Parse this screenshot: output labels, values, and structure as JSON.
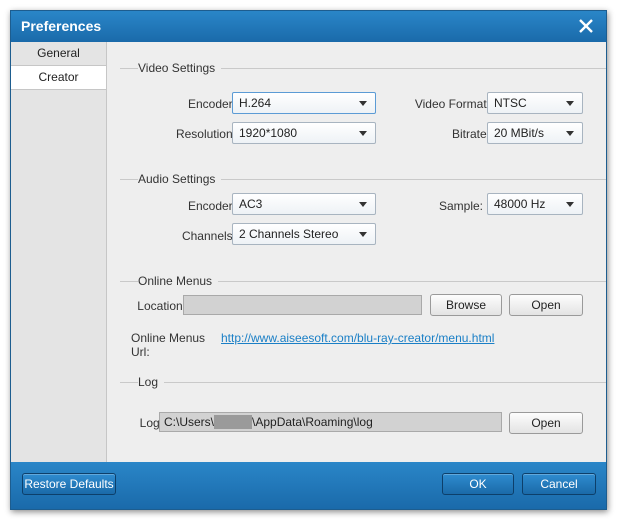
{
  "window": {
    "title": "Preferences"
  },
  "sidebar": {
    "items": [
      {
        "label": "General"
      },
      {
        "label": "Creator"
      }
    ]
  },
  "video": {
    "section_title": "Video Settings",
    "encoder_label": "Encoder:",
    "encoder_value": "H.264",
    "format_label": "Video Format:",
    "format_value": "NTSC",
    "resolution_label": "Resolution:",
    "resolution_value": "1920*1080",
    "bitrate_label": "Bitrate:",
    "bitrate_value": "20 MBit/s"
  },
  "audio": {
    "section_title": "Audio Settings",
    "encoder_label": "Encoder:",
    "encoder_value": "AC3",
    "sample_label": "Sample:",
    "sample_value": "48000 Hz",
    "channels_label": "Channels:",
    "channels_value": "2 Channels Stereo"
  },
  "online": {
    "section_title": "Online Menus",
    "location_label": "Location:",
    "location_value": "",
    "browse_label": "Browse",
    "open_label": "Open",
    "url_label": "Online Menus Url:",
    "url_value": "http://www.aiseesoft.com/blu-ray-creator/menu.html"
  },
  "log": {
    "section_title": "Log",
    "label": "Log:",
    "path_prefix": "C:\\Users\\",
    "path_suffix": "\\AppData\\Roaming\\log",
    "open_label": "Open"
  },
  "footer": {
    "restore_label": "Restore Defaults",
    "ok_label": "OK",
    "cancel_label": "Cancel"
  },
  "colors": {
    "titlebar": "#1e74b6",
    "link": "#1a7fc6",
    "panel": "#eeeeee"
  },
  "icons": {
    "close": "close-icon",
    "dropdown": "chevron-down-icon"
  }
}
